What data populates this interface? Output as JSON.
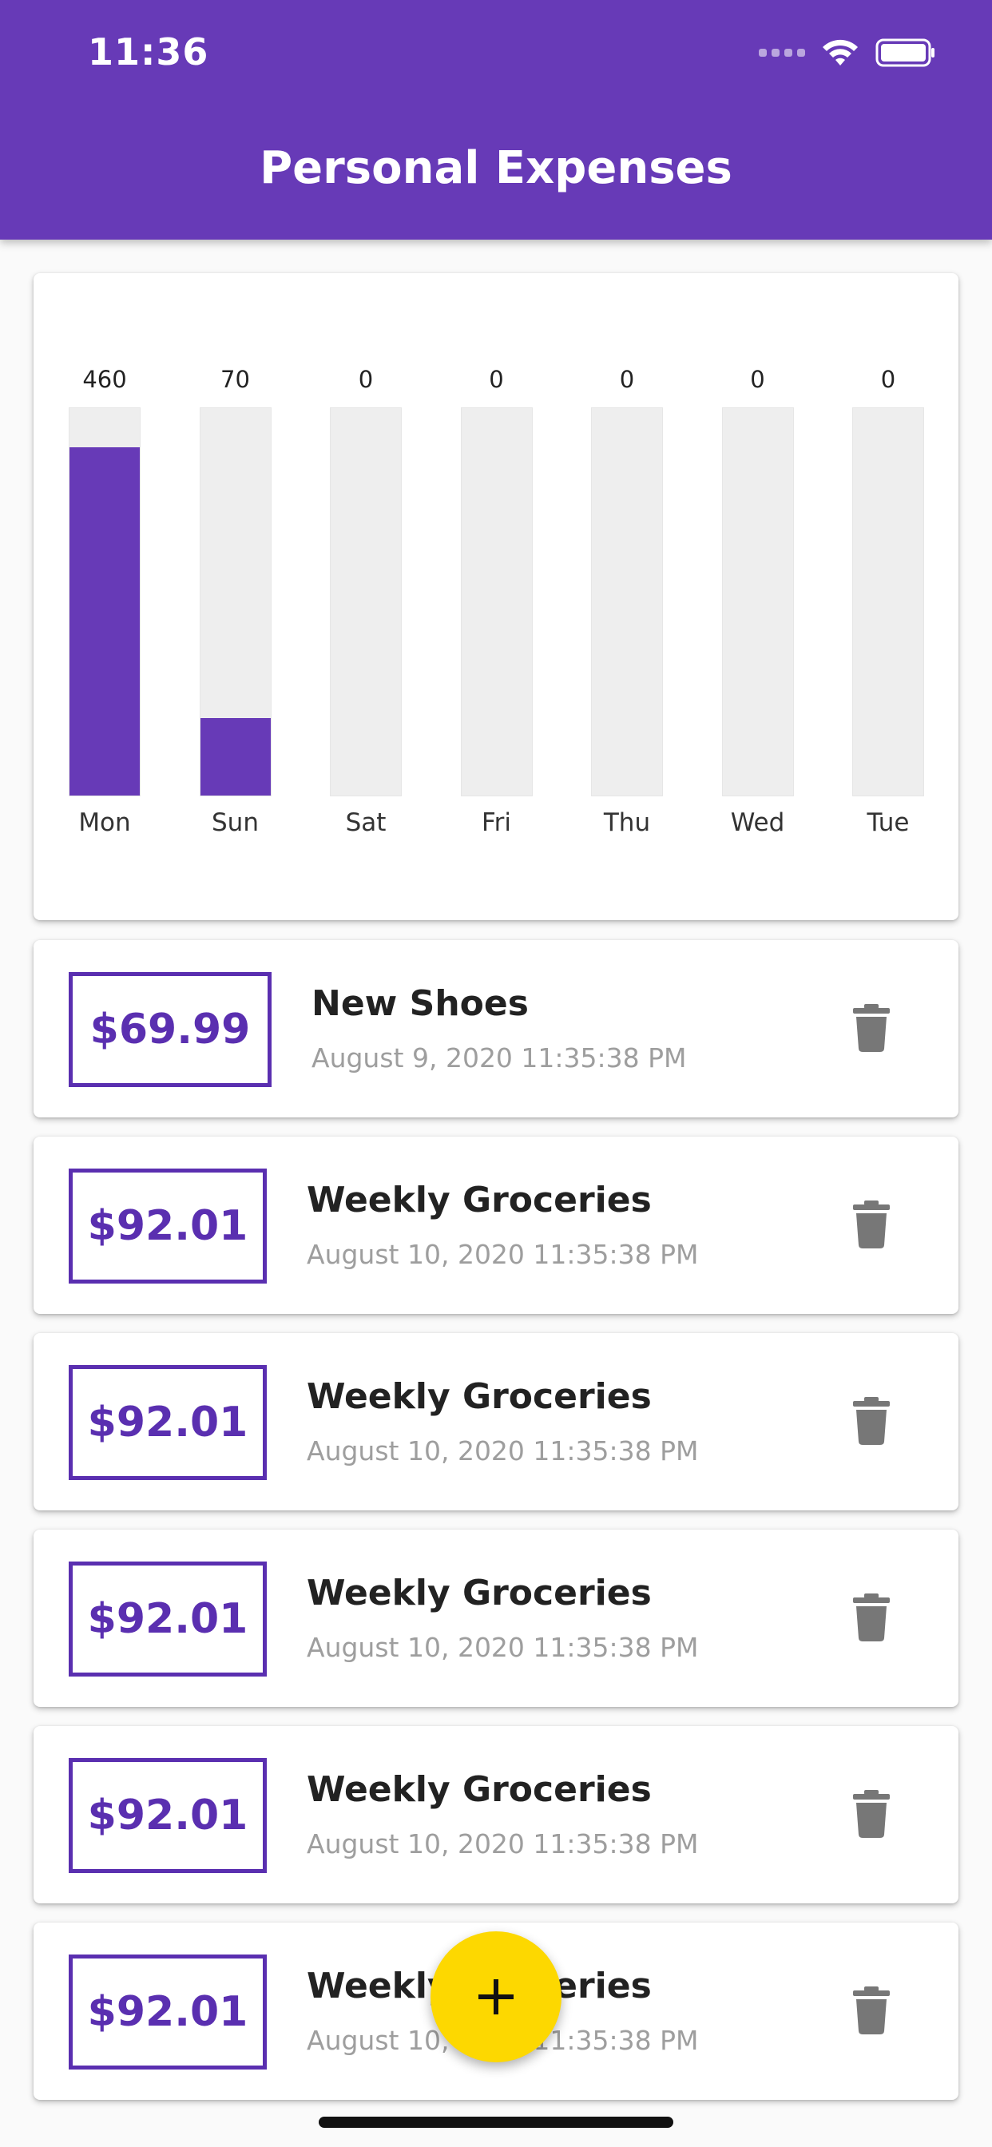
{
  "status_bar": {
    "time": "11:36"
  },
  "app_bar": {
    "title": "Personal Expenses"
  },
  "chart_data": {
    "type": "bar",
    "categories": [
      "Mon",
      "Sun",
      "Sat",
      "Fri",
      "Thu",
      "Wed",
      "Tue"
    ],
    "values": [
      460,
      70,
      0,
      0,
      0,
      0,
      0
    ],
    "value_labels": [
      "460",
      "70",
      "0",
      "0",
      "0",
      "0",
      "0"
    ],
    "fill_fractions": [
      0.9,
      0.2,
      0,
      0,
      0,
      0,
      0
    ],
    "bar_color": "#673ab7",
    "track_color": "#eeeeee"
  },
  "transactions": [
    {
      "amount": "$69.99",
      "title": "New Shoes",
      "date": "August 9, 2020 11:35:38 PM"
    },
    {
      "amount": "$92.01",
      "title": "Weekly Groceries",
      "date": "August 10, 2020 11:35:38 PM"
    },
    {
      "amount": "$92.01",
      "title": "Weekly Groceries",
      "date": "August 10, 2020 11:35:38 PM"
    },
    {
      "amount": "$92.01",
      "title": "Weekly Groceries",
      "date": "August 10, 2020 11:35:38 PM"
    },
    {
      "amount": "$92.01",
      "title": "Weekly Groceries",
      "date": "August 10, 2020 11:35:38 PM"
    },
    {
      "amount": "$92.01",
      "title": "Weekly Groceries",
      "date": "August 10, 2020 11:35:38 PM"
    }
  ],
  "icons": {
    "delete": "trash-icon",
    "add": "plus-icon",
    "wifi": "wifi-icon",
    "battery": "battery-icon"
  },
  "colors": {
    "primary": "#673ab7",
    "accent": "#fdd800"
  }
}
